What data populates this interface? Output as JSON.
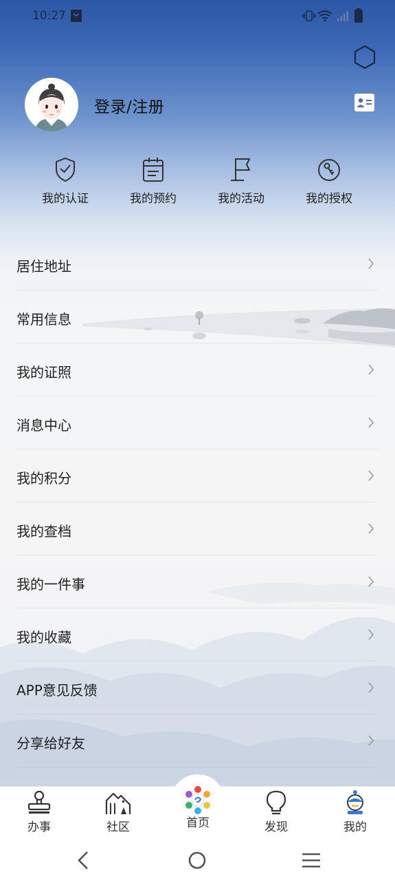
{
  "status_bar": {
    "time": "10:27"
  },
  "profile": {
    "login_label": "登录/注册"
  },
  "quick_actions": [
    {
      "label": "我的认证",
      "icon": "shield-check-icon"
    },
    {
      "label": "我的预约",
      "icon": "calendar-clipboard-icon"
    },
    {
      "label": "我的活动",
      "icon": "flag-icon"
    },
    {
      "label": "我的授权",
      "icon": "key-circle-icon"
    }
  ],
  "menu": [
    {
      "label": "居住地址"
    },
    {
      "label": "常用信息"
    },
    {
      "label": "我的证照"
    },
    {
      "label": "消息中心"
    },
    {
      "label": "我的积分"
    },
    {
      "label": "我的查档"
    },
    {
      "label": "我的一件事"
    },
    {
      "label": "我的收藏"
    },
    {
      "label": "APP意见反馈"
    },
    {
      "label": "分享给好友"
    }
  ],
  "tabs": [
    {
      "label": "办事",
      "icon": "stamp-icon"
    },
    {
      "label": "社区",
      "icon": "community-building-icon"
    },
    {
      "label": "首页",
      "icon": "home-logo-icon"
    },
    {
      "label": "发现",
      "icon": "lightbulb-icon"
    },
    {
      "label": "我的",
      "icon": "profile-mascot-icon",
      "active": true
    }
  ],
  "colors": {
    "header_blue": "#2c57a6",
    "accent_blue": "#3b77c9",
    "icon_dark": "#333333"
  }
}
